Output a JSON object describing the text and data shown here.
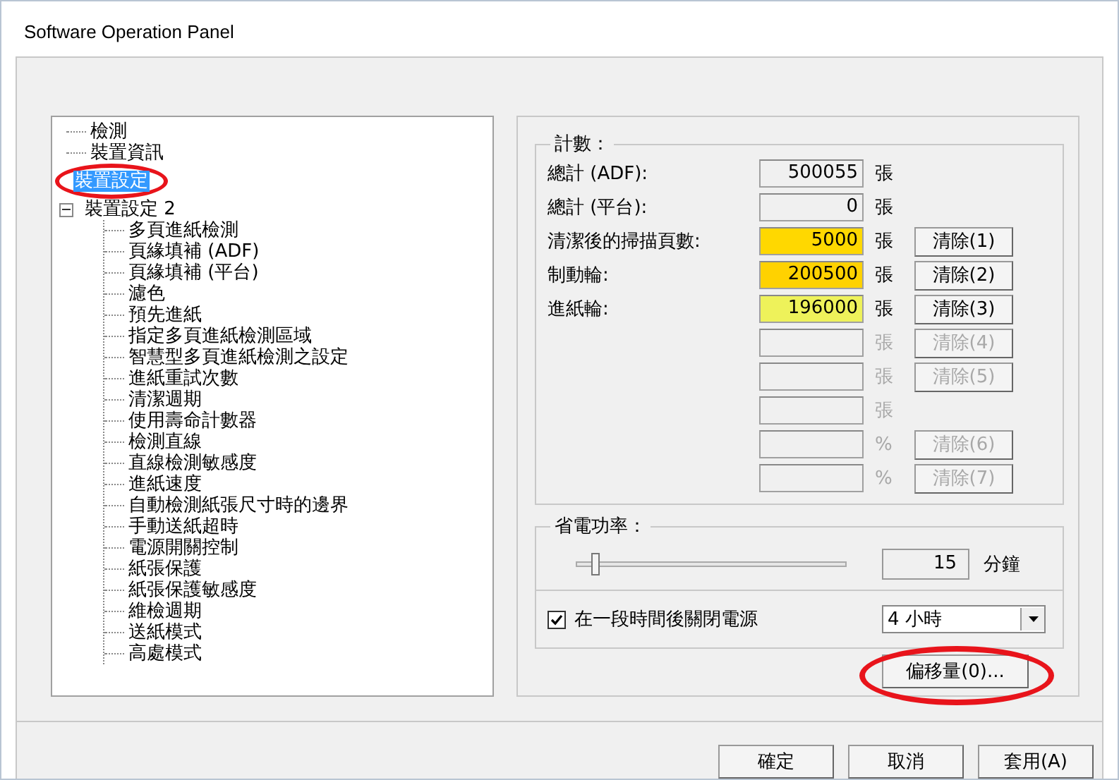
{
  "window": {
    "title": "Software Operation Panel"
  },
  "tree": [
    {
      "label": "檢測",
      "selected": false
    },
    {
      "label": "裝置資訊",
      "selected": false
    },
    {
      "label": "裝置設定",
      "selected": true
    },
    {
      "label": "裝置設定 2",
      "selected": false,
      "expanded": true,
      "children": [
        {
          "label": "多頁進紙檢測",
          "selected": false
        },
        {
          "label": "頁緣填補 (ADF)",
          "selected": false
        },
        {
          "label": "頁緣填補 (平台)",
          "selected": false
        },
        {
          "label": "濾色",
          "selected": false
        },
        {
          "label": "預先進紙",
          "selected": false
        },
        {
          "label": "指定多頁進紙檢測區域",
          "selected": false
        },
        {
          "label": "智慧型多頁進紙檢測之設定",
          "selected": false
        },
        {
          "label": "進紙重試次數",
          "selected": false
        },
        {
          "label": "清潔週期",
          "selected": false
        },
        {
          "label": "使用壽命計數器",
          "selected": false
        },
        {
          "label": "檢測直線",
          "selected": false
        },
        {
          "label": "直線檢測敏感度",
          "selected": false
        },
        {
          "label": "進紙速度",
          "selected": false
        },
        {
          "label": "自動檢測紙張尺寸時的邊界",
          "selected": false
        },
        {
          "label": "手動送紙超時",
          "selected": false
        },
        {
          "label": "電源開關控制",
          "selected": false
        },
        {
          "label": "紙張保護",
          "selected": false
        },
        {
          "label": "紙張保護敏感度",
          "selected": false
        },
        {
          "label": "維檢週期",
          "selected": false
        },
        {
          "label": "送紙模式",
          "selected": false
        },
        {
          "label": "高處模式",
          "selected": false
        }
      ]
    }
  ],
  "counters": {
    "title": "計數：",
    "rows": [
      {
        "label": "總計 (ADF):",
        "value": "500055",
        "unit": "張",
        "color": "#f0f0f0",
        "disabled": false
      },
      {
        "label": "總計 (平台):",
        "value": "0",
        "unit": "張",
        "color": "#f0f0f0",
        "disabled": false
      },
      {
        "label": "清潔後的掃描頁數:",
        "value": "5000",
        "unit": "張",
        "color": "#ffd800",
        "disabled": false,
        "button": "清除(1)"
      },
      {
        "label": "制動輪:",
        "value": "200500",
        "unit": "張",
        "color": "#ffd200",
        "disabled": false,
        "button": "清除(2)"
      },
      {
        "label": "進紙輪:",
        "value": "196000",
        "unit": "張",
        "color": "#eef25a",
        "disabled": false,
        "button": "清除(3)"
      },
      {
        "unit": "張",
        "color": "#f0f0f0",
        "disabled": true,
        "button": "清除(4)"
      },
      {
        "unit": "張",
        "color": "#f0f0f0",
        "disabled": true,
        "button": "清除(5)"
      },
      {
        "unit": "張",
        "color": "#f0f0f0",
        "disabled": true
      },
      {
        "unit": "%",
        "color": "#f0f0f0",
        "disabled": true,
        "button": "清除(6)"
      },
      {
        "unit": "%",
        "color": "#f0f0f0",
        "disabled": true,
        "button": "清除(7)"
      }
    ]
  },
  "power": {
    "title": "省電功率：",
    "level": 0.07,
    "value": "15",
    "unit": "分鐘",
    "auto_off": {
      "label": "在一段時間後關閉電源",
      "checked": true,
      "value": "4 小時"
    }
  },
  "offset_button": "偏移量(0)...",
  "buttons": [
    "確定",
    "取消",
    "套用(A)"
  ]
}
